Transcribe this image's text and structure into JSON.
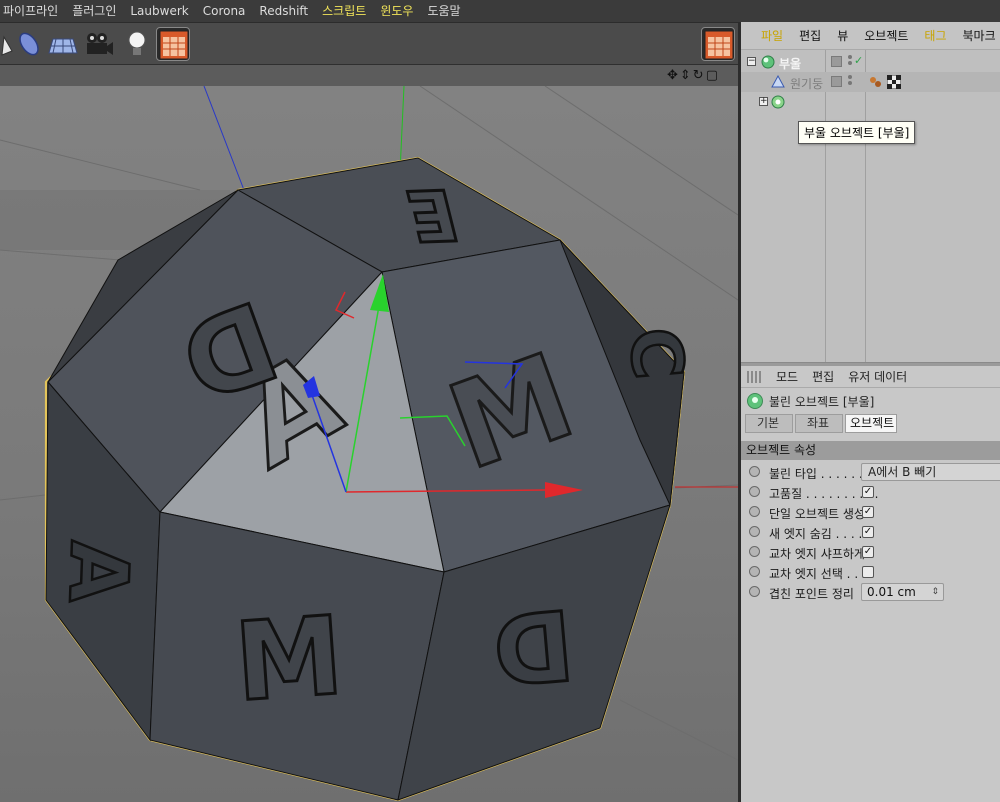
{
  "menu": [
    "파이프라인",
    "플러그인",
    "Laubwerk",
    "Corona",
    "Redshift",
    "스크립트",
    "윈도우",
    "도움말"
  ],
  "menu_highlight_color": "#f2e55a",
  "viewport": {
    "letters": [
      "A",
      "M",
      "D",
      "E",
      "M",
      "D",
      "A",
      "C"
    ],
    "selection_outline_color": "#f0d060",
    "axis_colors": {
      "x": "#e0282c",
      "y": "#29d22d",
      "z": "#2434e0"
    }
  },
  "object_manager": {
    "tabs": [
      "파일",
      "편집",
      "뷰",
      "오브젝트",
      "태그",
      "북마크"
    ],
    "highlight_tabs": [
      "파일",
      "태그"
    ],
    "objects": [
      {
        "name": "부울",
        "icon": "boole-icon",
        "expanded": true
      },
      {
        "name": "원기둥",
        "icon": "cylinder-icon",
        "dimmed": true
      },
      {
        "name": "",
        "icon": "polyhedron-icon",
        "expanded": false
      }
    ],
    "tooltip": "부울 오브젝트 [부울]"
  },
  "attribute_manager": {
    "modes": [
      "모드",
      "편집",
      "유저 데이터"
    ],
    "object_title": "불린 오브젝트 [부울]",
    "tabs": [
      "기본",
      "좌표",
      "오브젝트"
    ],
    "active_tab": "오브젝트",
    "section": "오브젝트 속성",
    "properties": [
      {
        "label": "불린 타입 . . . . . . .",
        "type": "dropdown",
        "value": "A에서 B 빼기"
      },
      {
        "label": "고품질 . . . . . . . . . .",
        "type": "checkbox",
        "checked": true
      },
      {
        "label": "단일 오브젝트 생성",
        "type": "checkbox",
        "checked": true
      },
      {
        "label": "새 엣지 숨김 . . . . .",
        "type": "checkbox",
        "checked": true
      },
      {
        "label": "교차 엣지 샤프하게",
        "type": "checkbox",
        "checked": true
      },
      {
        "label": "교차 엣지 선택 . . .",
        "type": "checkbox",
        "checked": false
      },
      {
        "label": "겹친 포인트 정리",
        "type": "number",
        "value": "0.01 cm"
      }
    ],
    "checkmark": "✓",
    "spinner": "⇕"
  }
}
